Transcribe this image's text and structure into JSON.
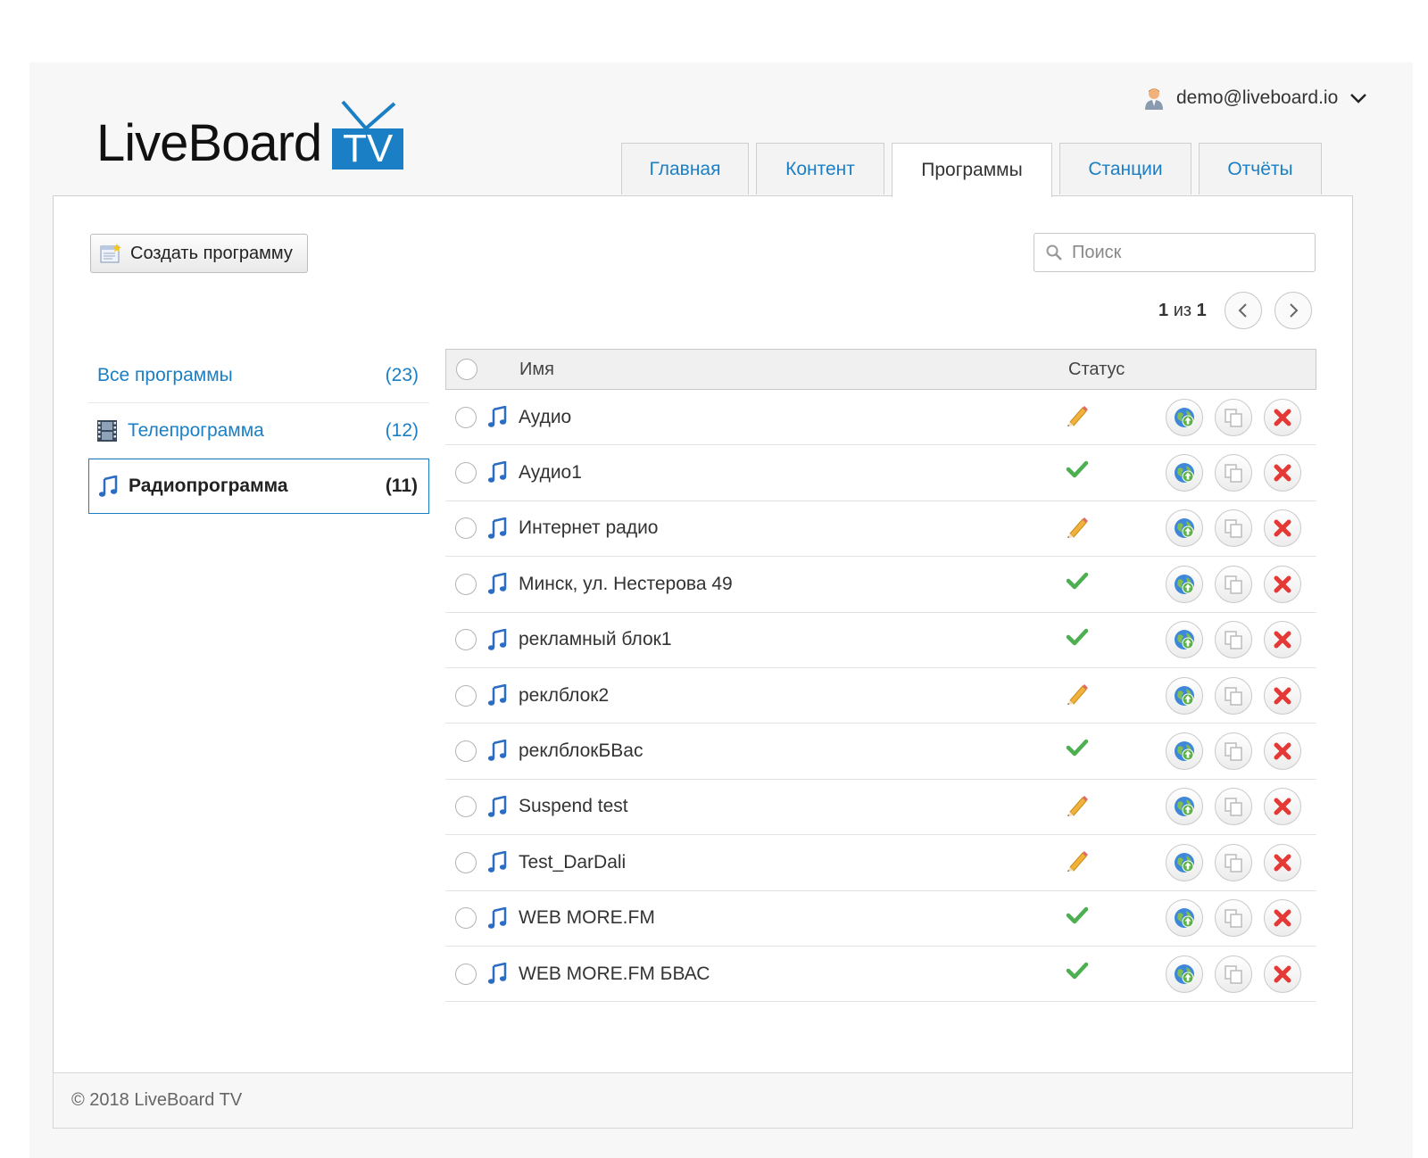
{
  "brand": {
    "name": "LiveBoard",
    "tv": "TV"
  },
  "user": {
    "email": "demo@liveboard.io"
  },
  "tabs": [
    {
      "label": "Главная"
    },
    {
      "label": "Контент"
    },
    {
      "label": "Программы"
    },
    {
      "label": "Станции"
    },
    {
      "label": "Отчёты"
    }
  ],
  "toolbar": {
    "create_label": "Создать программу",
    "search_placeholder": "Поиск"
  },
  "pager": {
    "current": "1",
    "sep": "из",
    "total": "1"
  },
  "sidebar": {
    "items": [
      {
        "label": "Все программы",
        "count": "(23)"
      },
      {
        "label": "Телепрограмма",
        "count": "(12)"
      },
      {
        "label": "Радиопрограмма",
        "count": "(11)"
      }
    ]
  },
  "table": {
    "columns": {
      "name": "Имя",
      "status": "Статус"
    },
    "rows": [
      {
        "name": "Аудио",
        "status": "draft"
      },
      {
        "name": "Аудио1",
        "status": "published"
      },
      {
        "name": "Интернет радио",
        "status": "draft"
      },
      {
        "name": "Минск, ул. Нестерова 49",
        "status": "published"
      },
      {
        "name": "рекламный блок1",
        "status": "published"
      },
      {
        "name": "реклблок2",
        "status": "draft"
      },
      {
        "name": "реклблокБВас",
        "status": "published"
      },
      {
        "name": "Suspend test",
        "status": "draft"
      },
      {
        "name": "Test_DarDali",
        "status": "draft"
      },
      {
        "name": "WEB MORE.FM",
        "status": "published"
      },
      {
        "name": "WEB MORE.FM БВАС",
        "status": "published"
      }
    ]
  },
  "footer": {
    "text": "© 2018 LiveBoard TV"
  },
  "colors": {
    "accent": "#1a7fc4",
    "check": "#4caf50",
    "delete": "#e53935"
  }
}
